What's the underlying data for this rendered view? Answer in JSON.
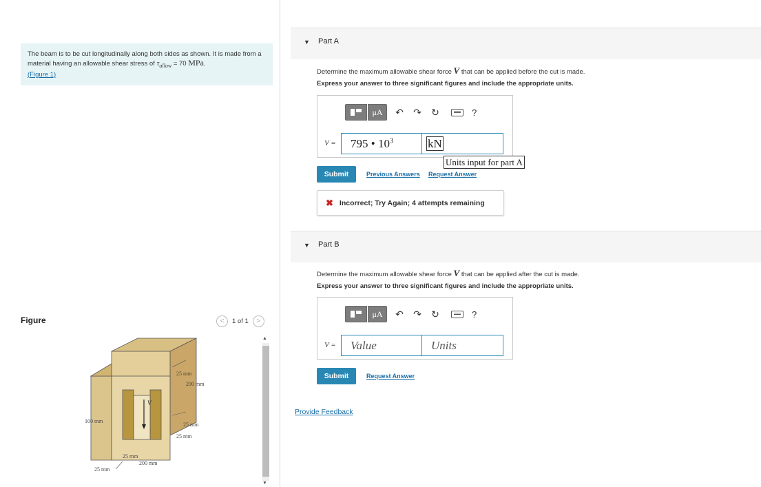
{
  "problem": {
    "text_before": "The beam is to be cut longitudinally along both sides as shown. It is made from a material having an allowable shear stress of ",
    "tau_symbol": "τ",
    "tau_subscript": "allow",
    "tau_value": " = 70 ",
    "tau_unit": "MPa",
    "text_after": ".",
    "figure_link": "(Figure 1)"
  },
  "figure": {
    "title": "Figure",
    "pager_text": "1 of 1",
    "labels": {
      "d1": "25 mm",
      "d2": "200 mm",
      "d3": "25 mm",
      "d4": "25 mm",
      "d5": "100 mm",
      "d6": "25 mm",
      "d7": "200 mm",
      "d8": "25 mm",
      "v": "V"
    }
  },
  "part_a": {
    "title": "Part A",
    "question_before": "Determine the maximum allowable shear force ",
    "question_var": "V",
    "question_after": " that can be applied before the cut is made.",
    "instruction": "Express your answer to three significant figures and include the appropriate units.",
    "var_label": "V =",
    "value_mantissa": "795 • 10",
    "value_exponent": "3",
    "units_value": "kN",
    "units_tooltip": "Units input for part A",
    "submit_label": "Submit",
    "previous_answers": "Previous Answers",
    "request_answer": "Request Answer",
    "feedback": "Incorrect; Try Again; 4 attempts remaining"
  },
  "part_b": {
    "title": "Part B",
    "question_before": "Determine the maximum allowable shear force ",
    "question_var": "V",
    "question_after": " that can be applied after the cut is made.",
    "instruction": "Express your answer to three significant figures and include the appropriate units.",
    "var_label": "V =",
    "value_placeholder": "Value",
    "units_placeholder": "Units",
    "submit_label": "Submit",
    "request_answer": "Request Answer"
  },
  "toolbar": {
    "mu_label": "μA",
    "help_label": "?"
  },
  "provide_feedback": "Provide Feedback",
  "colors": {
    "accent": "#2987b4",
    "link": "#1a6fa8",
    "problem_bg": "#e6f4f6",
    "error": "#cc2222"
  }
}
